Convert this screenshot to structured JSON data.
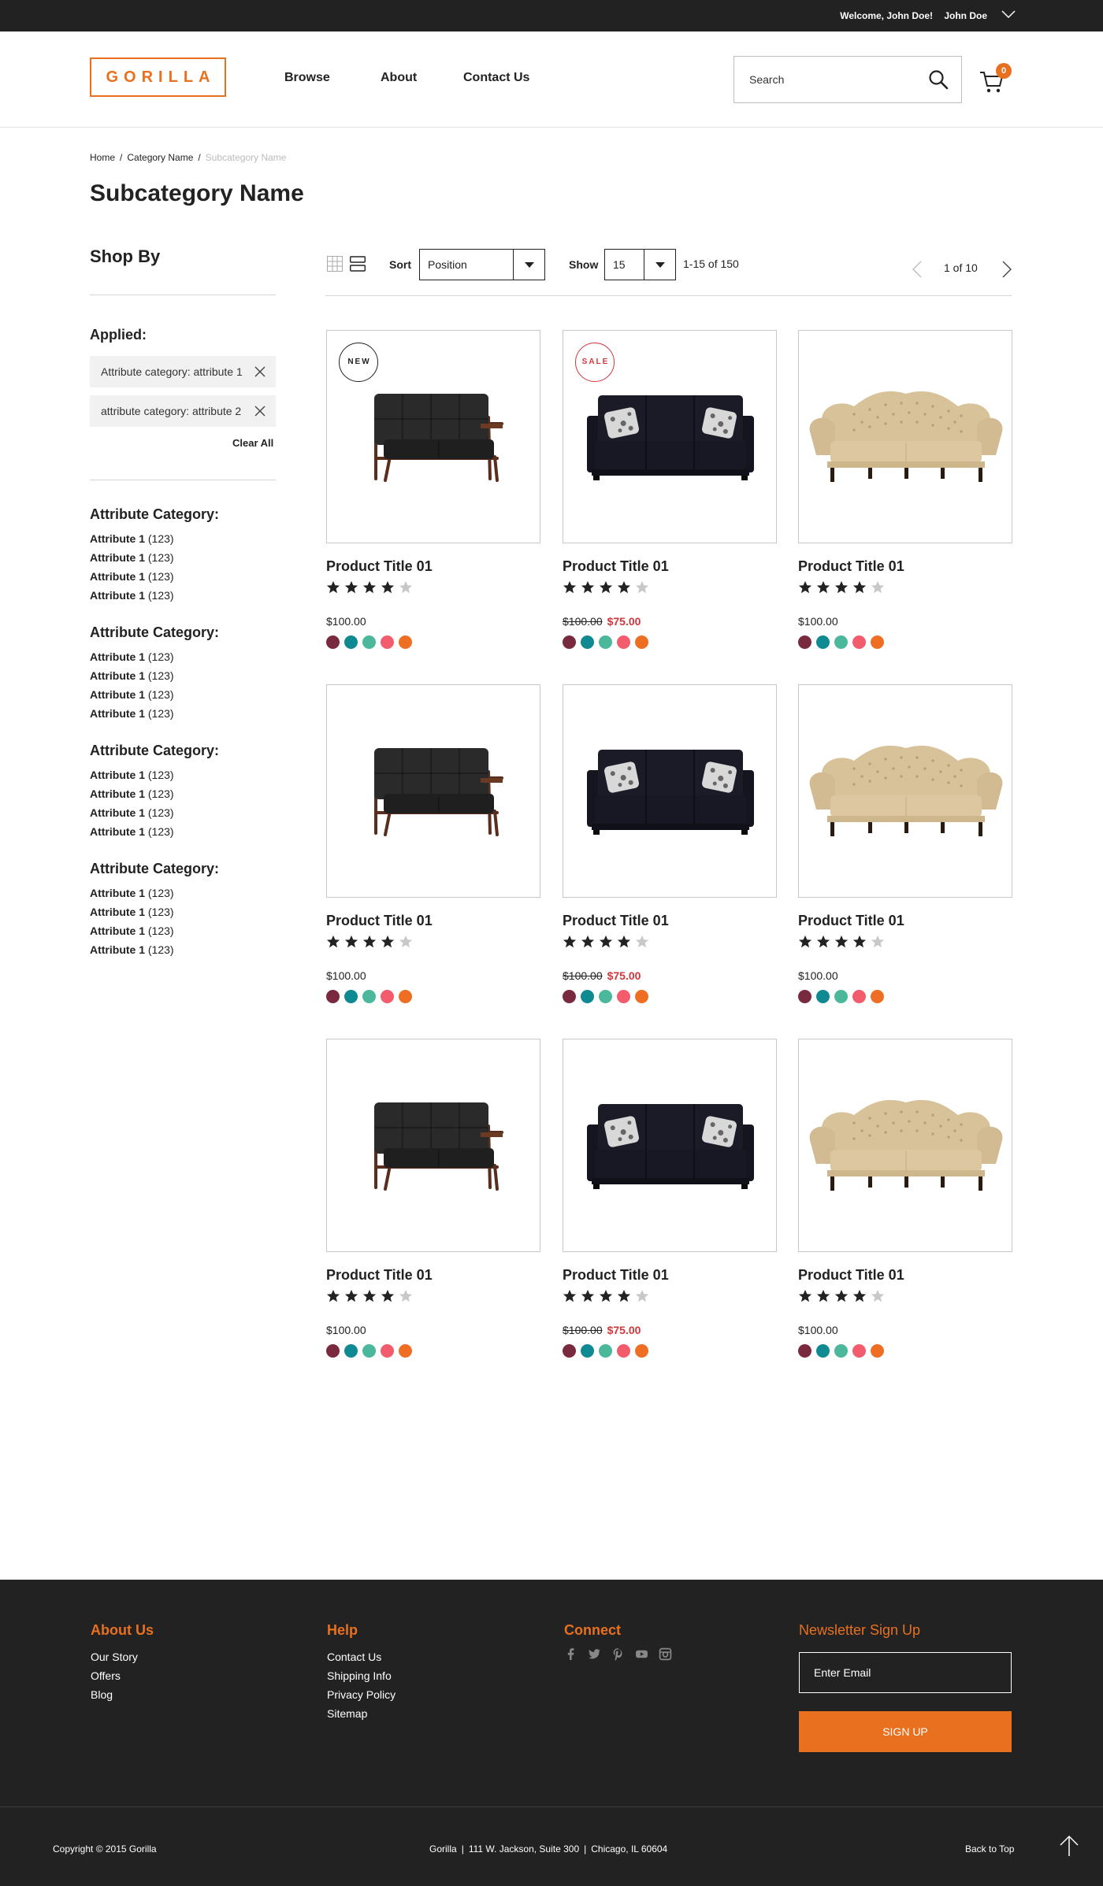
{
  "topbar": {
    "welcome": "Welcome, John Doe!",
    "user": "John Doe"
  },
  "header": {
    "logo": "GORILLA",
    "nav": [
      "Browse",
      "About",
      "Contact Us"
    ],
    "search_placeholder": "Search",
    "cart_count": "0"
  },
  "breadcrumb": {
    "home": "Home",
    "category": "Category Name",
    "current": "Subcategory Name",
    "separator": "/"
  },
  "page_title": "Subcategory Name",
  "sidebar": {
    "heading": "Shop By",
    "applied_label": "Applied:",
    "applied": [
      "Attribute category: attribute 1",
      "attribute category: attribute 2"
    ],
    "clear_all": "Clear All",
    "groups": [
      {
        "title": "Attribute Category:",
        "items": [
          {
            "name": "Attribute 1",
            "count": "(123)"
          },
          {
            "name": "Attribute 1",
            "count": "(123)"
          },
          {
            "name": "Attribute 1",
            "count": "(123)"
          },
          {
            "name": "Attribute 1",
            "count": "(123)"
          }
        ]
      },
      {
        "title": "Attribute Category:",
        "items": [
          {
            "name": "Attribute 1",
            "count": "(123)"
          },
          {
            "name": "Attribute 1",
            "count": "(123)"
          },
          {
            "name": "Attribute 1",
            "count": "(123)"
          },
          {
            "name": "Attribute 1",
            "count": "(123)"
          }
        ]
      },
      {
        "title": "Attribute Category:",
        "items": [
          {
            "name": "Attribute 1",
            "count": "(123)"
          },
          {
            "name": "Attribute 1",
            "count": "(123)"
          },
          {
            "name": "Attribute 1",
            "count": "(123)"
          },
          {
            "name": "Attribute 1",
            "count": "(123)"
          }
        ]
      },
      {
        "title": "Attribute Category:",
        "items": [
          {
            "name": "Attribute 1",
            "count": "(123)"
          },
          {
            "name": "Attribute 1",
            "count": "(123)"
          },
          {
            "name": "Attribute 1",
            "count": "(123)"
          },
          {
            "name": "Attribute 1",
            "count": "(123)"
          }
        ]
      }
    ]
  },
  "toolbar": {
    "sort_label": "Sort",
    "sort_value": "Position",
    "show_label": "Show",
    "show_value": "15",
    "count_text": "1-15 of 150",
    "page_text": "1 of 10"
  },
  "products": [
    {
      "title": "Product Title 01",
      "image": "black-leather-loveseat",
      "badge": "NEW",
      "badge_type": "new",
      "rating": 4,
      "price": "$100.00",
      "old_price": "",
      "sale_price": ""
    },
    {
      "title": "Product Title 01",
      "image": "black-fabric-sofa",
      "badge": "SALE",
      "badge_type": "sale",
      "rating": 4,
      "price": "",
      "old_price": "$100.00",
      "sale_price": "$75.00"
    },
    {
      "title": "Product Title 01",
      "image": "beige-tufted-sofa",
      "badge": "",
      "badge_type": "",
      "rating": 4,
      "price": "$100.00",
      "old_price": "",
      "sale_price": ""
    },
    {
      "title": "Product Title 01",
      "image": "black-leather-loveseat",
      "badge": "",
      "badge_type": "",
      "rating": 4,
      "price": "$100.00",
      "old_price": "",
      "sale_price": ""
    },
    {
      "title": "Product Title 01",
      "image": "black-fabric-sofa",
      "badge": "",
      "badge_type": "",
      "rating": 4,
      "price": "",
      "old_price": "$100.00",
      "sale_price": "$75.00"
    },
    {
      "title": "Product Title 01",
      "image": "beige-tufted-sofa",
      "badge": "",
      "badge_type": "",
      "rating": 4,
      "price": "$100.00",
      "old_price": "",
      "sale_price": ""
    },
    {
      "title": "Product Title 01",
      "image": "black-leather-loveseat",
      "badge": "",
      "badge_type": "",
      "rating": 4,
      "price": "$100.00",
      "old_price": "",
      "sale_price": ""
    },
    {
      "title": "Product Title 01",
      "image": "black-fabric-sofa",
      "badge": "",
      "badge_type": "",
      "rating": 4,
      "price": "",
      "old_price": "$100.00",
      "sale_price": "$75.00"
    },
    {
      "title": "Product Title 01",
      "image": "beige-tufted-sofa",
      "badge": "",
      "badge_type": "",
      "rating": 4,
      "price": "$100.00",
      "old_price": "",
      "sale_price": ""
    }
  ],
  "swatch_colors": [
    "#7a2a3e",
    "#0f8a93",
    "#4bb89b",
    "#f25c6c",
    "#ee6f24"
  ],
  "colors": {
    "accent": "#e8701f",
    "sale": "#d3363a",
    "dark": "#222222"
  },
  "footer": {
    "about_title": "About Us",
    "about_links": [
      "Our Story",
      "Offers",
      "Blog"
    ],
    "help_title": "Help",
    "help_links": [
      "Contact Us",
      "Shipping Info",
      "Privacy Policy",
      "Sitemap"
    ],
    "connect_title": "Connect",
    "social_icons": [
      "facebook-icon",
      "twitter-icon",
      "pinterest-icon",
      "youtube-icon",
      "instagram-icon"
    ],
    "newsletter_title": "Newsletter Sign Up",
    "email_placeholder": "Enter Email",
    "signup_label": "SIGN UP",
    "copyright": "Copyright © 2015 Gorilla",
    "address": [
      "Gorilla",
      "111 W. Jackson, Suite 300",
      "Chicago, IL 60604"
    ],
    "address_separator": "|",
    "back_to_top": "Back to Top"
  }
}
